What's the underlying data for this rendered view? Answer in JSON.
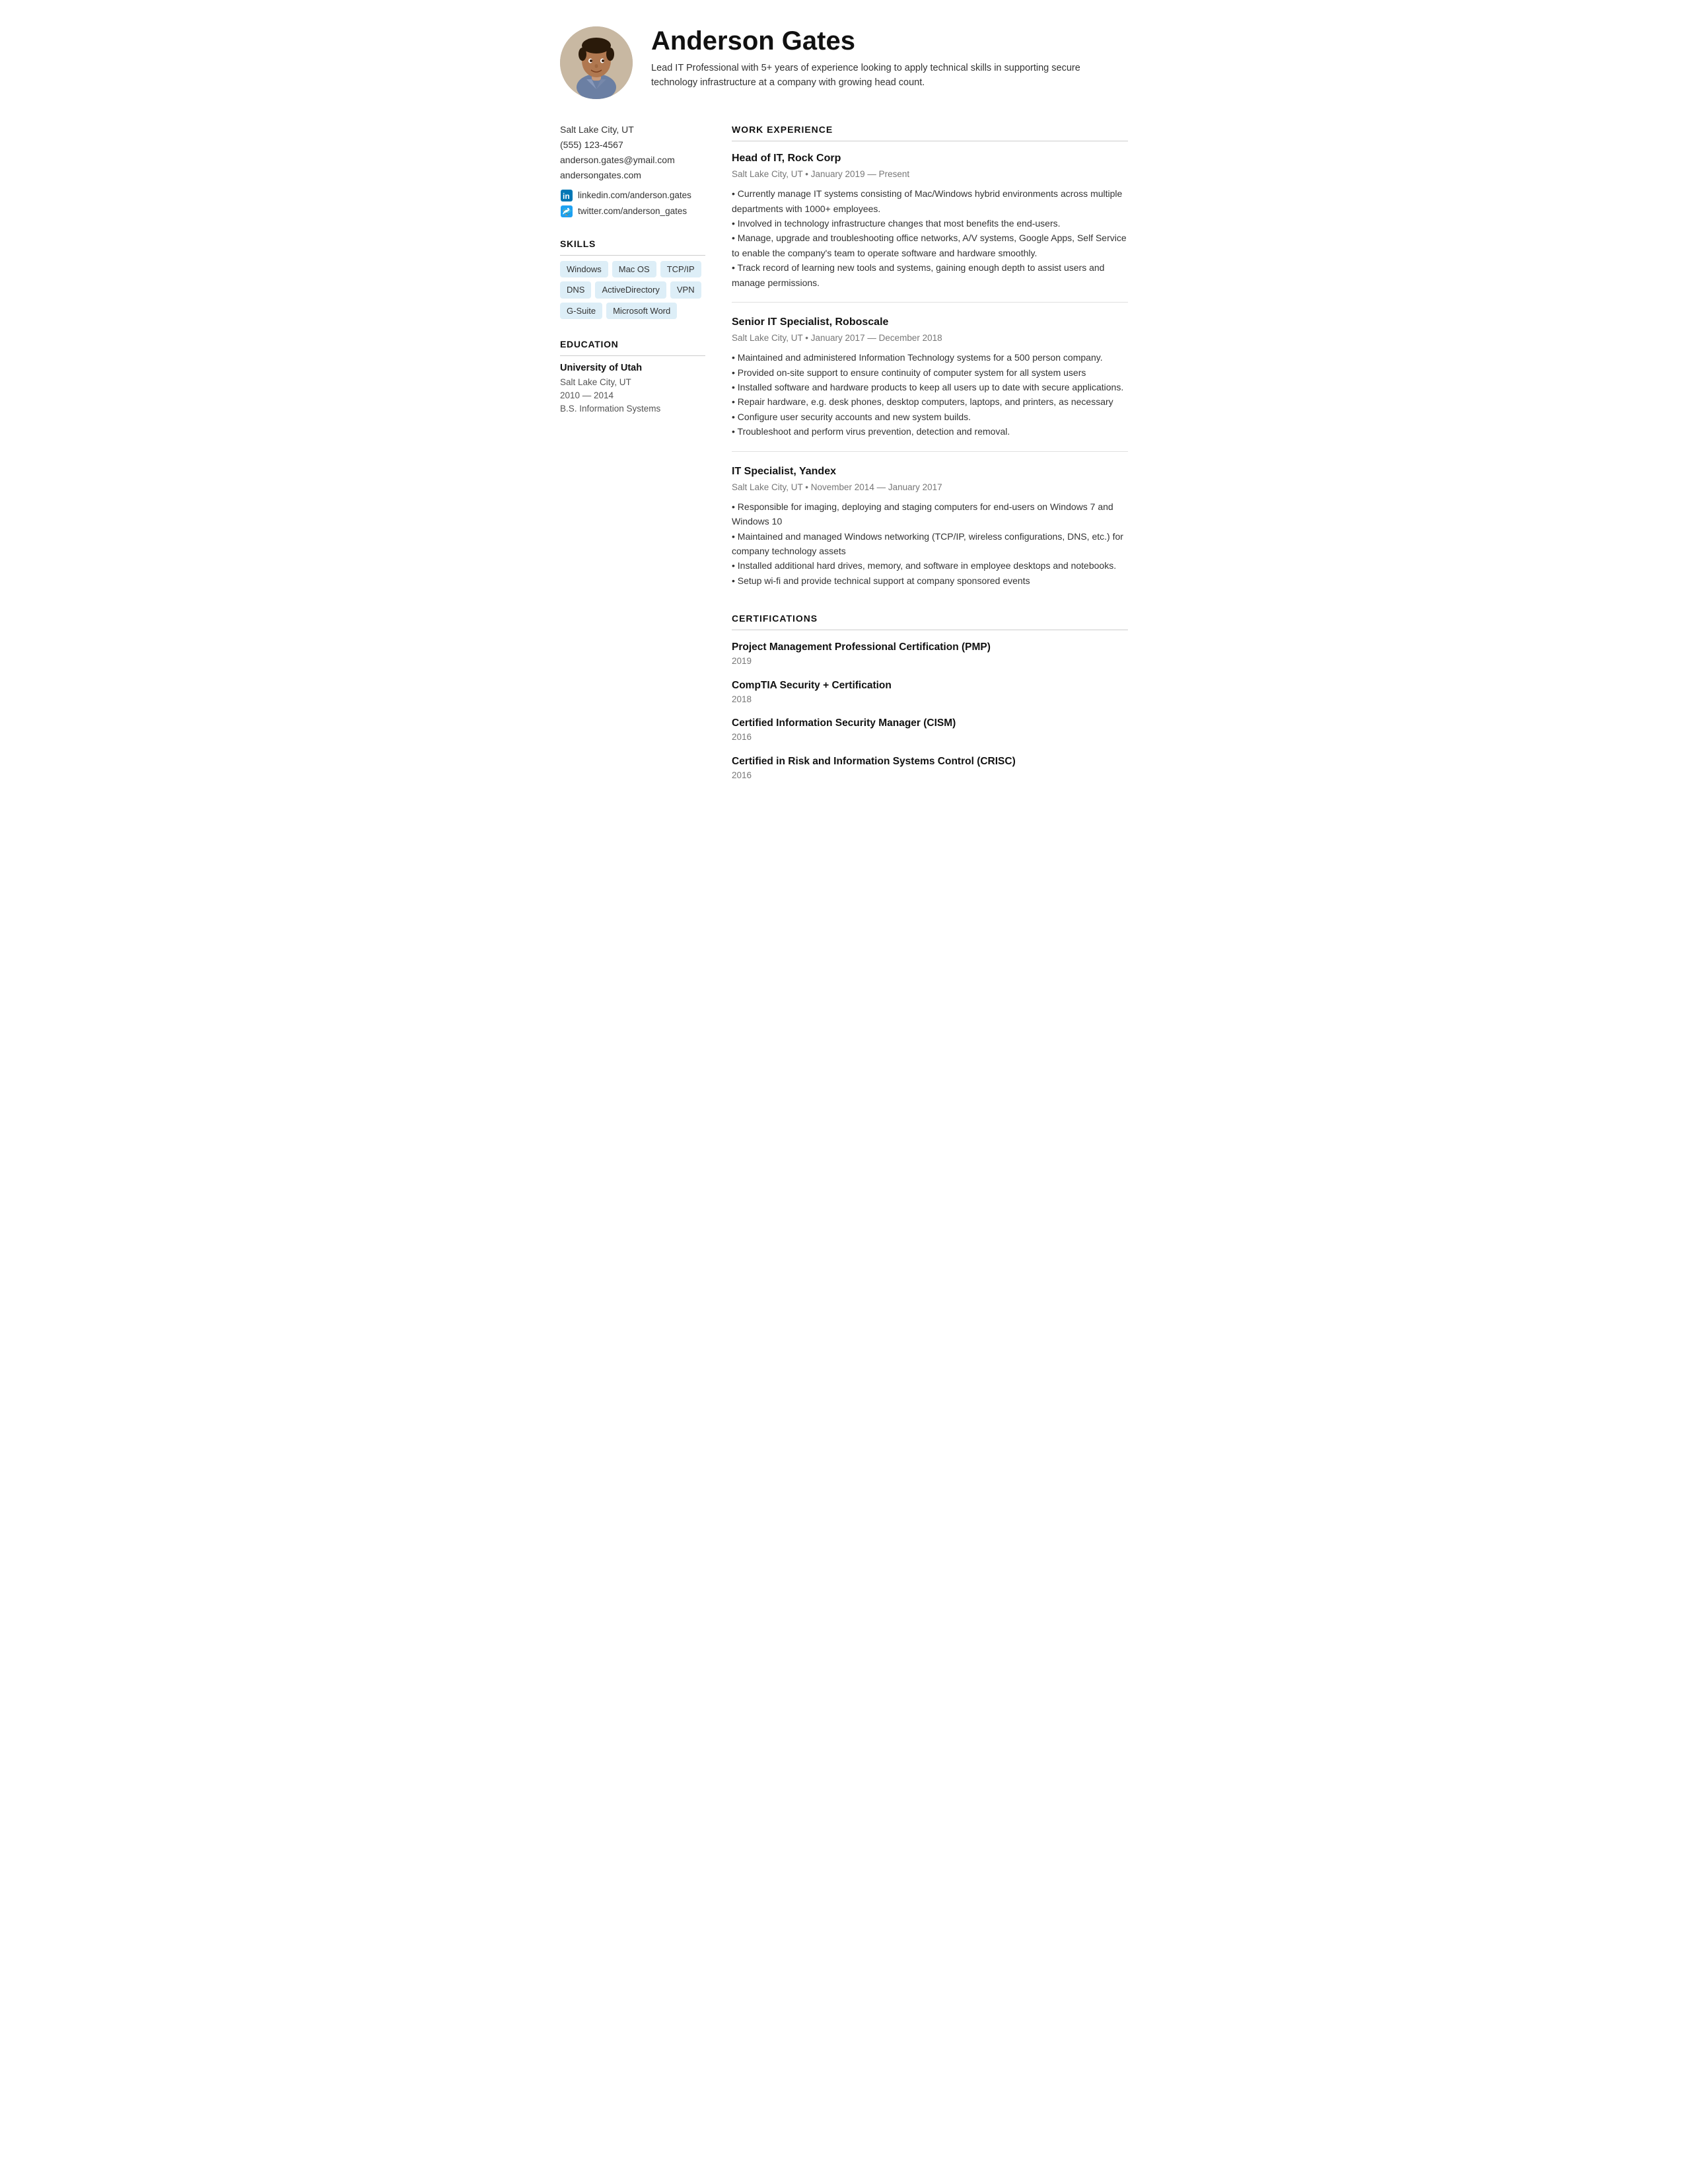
{
  "header": {
    "name": "Anderson Gates",
    "summary": "Lead IT Professional with 5+ years of experience looking to apply technical skills in supporting secure technology infrastructure at a company with growing head count."
  },
  "sidebar": {
    "contact": {
      "location": "Salt Lake City, UT",
      "phone": "(555) 123-4567",
      "email": "anderson.gates@ymail.com",
      "website": "andersongates.com"
    },
    "social": [
      {
        "icon": "linkedin",
        "label": "linkedin.com/anderson.gates"
      },
      {
        "icon": "twitter",
        "label": "twitter.com/anderson_gates"
      }
    ],
    "skills_heading": "SKILLS",
    "skills": [
      "Windows",
      "Mac OS",
      "TCP/IP",
      "DNS",
      "ActiveDirectory",
      "VPN",
      "G-Suite",
      "Microsoft Word"
    ],
    "education_heading": "EDUCATION",
    "education": [
      {
        "school": "University of Utah",
        "location": "Salt Lake City, UT",
        "years": "2010 — 2014",
        "degree": "B.S. Information Systems"
      }
    ]
  },
  "main": {
    "work_heading": "WORK EXPERIENCE",
    "jobs": [
      {
        "title": "Head of IT, Rock Corp",
        "meta": "Salt Lake City, UT • January 2019 — Present",
        "bullets": "• Currently manage IT systems consisting of Mac/Windows hybrid environments across multiple departments with 1000+ employees.\n• Involved in technology infrastructure changes that most benefits the end-users.\n• Manage, upgrade and troubleshooting office networks, A/V systems, Google Apps, Self Service to enable the company's team to operate software and hardware smoothly.\n• Track record of learning new tools and systems, gaining enough depth to assist users and manage permissions."
      },
      {
        "title": "Senior IT Specialist, Roboscale",
        "meta": "Salt Lake City, UT • January 2017 — December 2018",
        "bullets": "• Maintained and administered Information Technology systems for a 500 person company.\n• Provided on-site support to ensure continuity of computer system for all system users\n• Installed software and hardware products to keep all users up to date with secure applications.\n• Repair hardware, e.g. desk phones, desktop computers, laptops, and printers, as necessary\n• Configure user security accounts and new system builds.\n• Troubleshoot and perform virus prevention, detection and removal."
      },
      {
        "title": "IT Specialist, Yandex",
        "meta": "Salt Lake City, UT • November 2014 — January 2017",
        "bullets": "• Responsible for imaging, deploying and staging computers for end-users on Windows 7 and Windows 10\n• Maintained and managed Windows networking (TCP/IP, wireless configurations, DNS, etc.) for company technology assets\n• Installed additional hard drives, memory, and software in employee desktops and notebooks.\n• Setup wi-fi and provide technical support at company sponsored events"
      }
    ],
    "cert_heading": "CERTIFICATIONS",
    "certifications": [
      {
        "name": "Project Management Professional Certification (PMP)",
        "year": "2019"
      },
      {
        "name": "CompTIA Security + Certification",
        "year": "2018"
      },
      {
        "name": "Certified Information Security Manager (CISM)",
        "year": "2016"
      },
      {
        "name": "Certified in Risk and Information Systems Control (CRISC)",
        "year": "2016"
      }
    ]
  }
}
